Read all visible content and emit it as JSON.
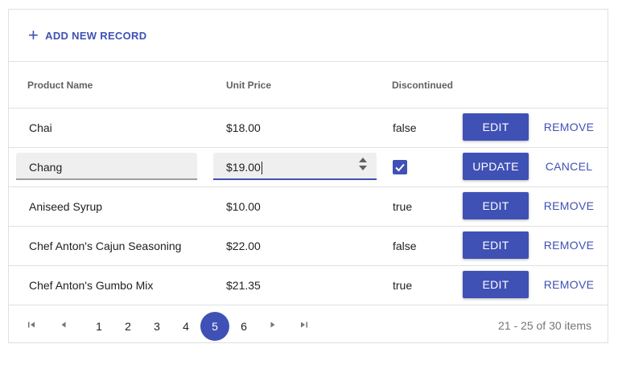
{
  "toolbar": {
    "add_label": "ADD NEW RECORD"
  },
  "columns": [
    "Product Name",
    "Unit Price",
    "Discontinued"
  ],
  "rows": [
    {
      "name": "Chai",
      "price": "$18.00",
      "discontinued": "false",
      "primary": "EDIT",
      "secondary": "REMOVE"
    },
    {
      "name": "Chang",
      "price": "$19.00",
      "discontinued": true,
      "primary": "UPDATE",
      "secondary": "CANCEL"
    },
    {
      "name": "Aniseed Syrup",
      "price": "$10.00",
      "discontinued": "true",
      "primary": "EDIT",
      "secondary": "REMOVE"
    },
    {
      "name": "Chef Anton's Cajun Seasoning",
      "price": "$22.00",
      "discontinued": "false",
      "primary": "EDIT",
      "secondary": "REMOVE"
    },
    {
      "name": "Chef Anton's Gumbo Mix",
      "price": "$21.35",
      "discontinued": "true",
      "primary": "EDIT",
      "secondary": "REMOVE"
    }
  ],
  "pager": {
    "pages": [
      "1",
      "2",
      "3",
      "4",
      "5",
      "6"
    ],
    "current": "5",
    "info": "21 - 25 of 30 items",
    "icons": [
      "first-page-icon",
      "prev-page-icon",
      "next-page-icon",
      "last-page-icon"
    ]
  },
  "colors": {
    "accent": "#3f51b5",
    "border": "#e0e0e0",
    "input_bg": "#efefef"
  }
}
